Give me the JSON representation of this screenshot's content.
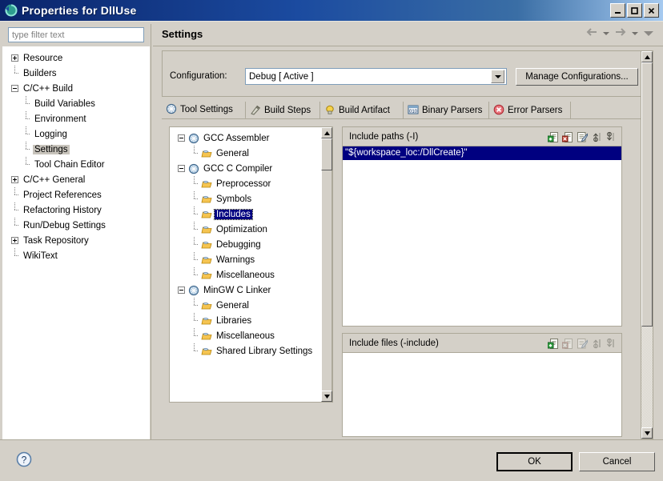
{
  "window": {
    "title": "Properties for DllUse",
    "icon": "eclipse-properties-icon",
    "minimize": "_",
    "maximize": "❐",
    "close": "✕"
  },
  "filter": {
    "placeholder": "type filter text",
    "value": ""
  },
  "sidebar": {
    "items": [
      {
        "label": "Resource",
        "depth": 0,
        "toggle": "plus",
        "selected": false
      },
      {
        "label": "Builders",
        "depth": 0,
        "toggle": "leaf",
        "selected": false
      },
      {
        "label": "C/C++ Build",
        "depth": 0,
        "toggle": "minus",
        "selected": false
      },
      {
        "label": "Build Variables",
        "depth": 1,
        "toggle": "leaf",
        "selected": false
      },
      {
        "label": "Environment",
        "depth": 1,
        "toggle": "leaf",
        "selected": false
      },
      {
        "label": "Logging",
        "depth": 1,
        "toggle": "leaf",
        "selected": false
      },
      {
        "label": "Settings",
        "depth": 1,
        "toggle": "leaf",
        "selected": true
      },
      {
        "label": "Tool Chain Editor",
        "depth": 1,
        "toggle": "leaf",
        "selected": false
      },
      {
        "label": "C/C++ General",
        "depth": 0,
        "toggle": "plus",
        "selected": false
      },
      {
        "label": "Project References",
        "depth": 0,
        "toggle": "leaf",
        "selected": false
      },
      {
        "label": "Refactoring History",
        "depth": 0,
        "toggle": "leaf",
        "selected": false
      },
      {
        "label": "Run/Debug Settings",
        "depth": 0,
        "toggle": "leaf",
        "selected": false
      },
      {
        "label": "Task Repository",
        "depth": 0,
        "toggle": "plus",
        "selected": false
      },
      {
        "label": "WikiText",
        "depth": 0,
        "toggle": "leaf",
        "selected": false
      }
    ]
  },
  "page": {
    "title": "Settings",
    "nav": [
      "back-arrow",
      "back-dropdown",
      "forward-arrow",
      "forward-dropdown",
      "menu-dropdown"
    ]
  },
  "configuration": {
    "label": "Configuration:",
    "value": "Debug  [ Active ]",
    "manage_label": "Manage Configurations..."
  },
  "tabs": [
    {
      "label": "Tool Settings",
      "icon": "tool-settings-icon",
      "active": true
    },
    {
      "label": "Build Steps",
      "icon": "build-steps-icon",
      "active": false
    },
    {
      "label": "Build Artifact",
      "icon": "build-artifact-icon",
      "active": false
    },
    {
      "label": "Binary Parsers",
      "icon": "binary-parsers-icon",
      "active": false
    },
    {
      "label": "Error Parsers",
      "icon": "error-parsers-icon",
      "active": false
    }
  ],
  "tool_tree": [
    {
      "label": "GCC Assembler",
      "depth": 0,
      "toggle": "minus",
      "icon": "tool-icon",
      "selected": false
    },
    {
      "label": "General",
      "depth": 1,
      "toggle": "leaf",
      "icon": "folder-icon",
      "selected": false
    },
    {
      "label": "GCC C Compiler",
      "depth": 0,
      "toggle": "minus",
      "icon": "tool-icon",
      "selected": false
    },
    {
      "label": "Preprocessor",
      "depth": 1,
      "toggle": "leaf",
      "icon": "folder-icon",
      "selected": false
    },
    {
      "label": "Symbols",
      "depth": 1,
      "toggle": "leaf",
      "icon": "folder-icon",
      "selected": false
    },
    {
      "label": "Includes",
      "depth": 1,
      "toggle": "leaf",
      "icon": "folder-icon",
      "selected": true
    },
    {
      "label": "Optimization",
      "depth": 1,
      "toggle": "leaf",
      "icon": "folder-icon",
      "selected": false
    },
    {
      "label": "Debugging",
      "depth": 1,
      "toggle": "leaf",
      "icon": "folder-icon",
      "selected": false
    },
    {
      "label": "Warnings",
      "depth": 1,
      "toggle": "leaf",
      "icon": "folder-icon",
      "selected": false
    },
    {
      "label": "Miscellaneous",
      "depth": 1,
      "toggle": "leaf",
      "icon": "folder-icon",
      "selected": false
    },
    {
      "label": "MinGW C Linker",
      "depth": 0,
      "toggle": "minus",
      "icon": "tool-icon",
      "selected": false
    },
    {
      "label": "General",
      "depth": 1,
      "toggle": "leaf",
      "icon": "folder-icon",
      "selected": false
    },
    {
      "label": "Libraries",
      "depth": 1,
      "toggle": "leaf",
      "icon": "folder-icon",
      "selected": false
    },
    {
      "label": "Miscellaneous",
      "depth": 1,
      "toggle": "leaf",
      "icon": "folder-icon",
      "selected": false
    },
    {
      "label": "Shared Library Settings",
      "depth": 1,
      "toggle": "leaf",
      "icon": "folder-icon",
      "selected": false
    }
  ],
  "include_paths": {
    "title": "Include paths (-I)",
    "entries": [
      "\"${workspace_loc:/DllCreate}\""
    ],
    "selected_index": 0,
    "toolbar": [
      {
        "name": "add-icon",
        "enabled": true
      },
      {
        "name": "delete-icon",
        "enabled": true
      },
      {
        "name": "edit-icon",
        "enabled": true
      },
      {
        "name": "move-up-icon",
        "enabled": true
      },
      {
        "name": "move-down-icon",
        "enabled": true
      }
    ]
  },
  "include_files": {
    "title": "Include files (-include)",
    "entries": [],
    "toolbar": [
      {
        "name": "add-icon",
        "enabled": true
      },
      {
        "name": "delete-icon",
        "enabled": false
      },
      {
        "name": "edit-icon",
        "enabled": false
      },
      {
        "name": "move-up-icon",
        "enabled": false
      },
      {
        "name": "move-down-icon",
        "enabled": false
      }
    ]
  },
  "footer": {
    "help": "?",
    "ok_label": "OK",
    "cancel_label": "Cancel"
  },
  "colors": {
    "titlebar_start": "#0a246a",
    "titlebar_end": "#a6caf0",
    "dialog_bg": "#d4d0c8",
    "selection": "#000080",
    "tree_selection_soft": "#c8c4bc",
    "border": "#aca899"
  }
}
